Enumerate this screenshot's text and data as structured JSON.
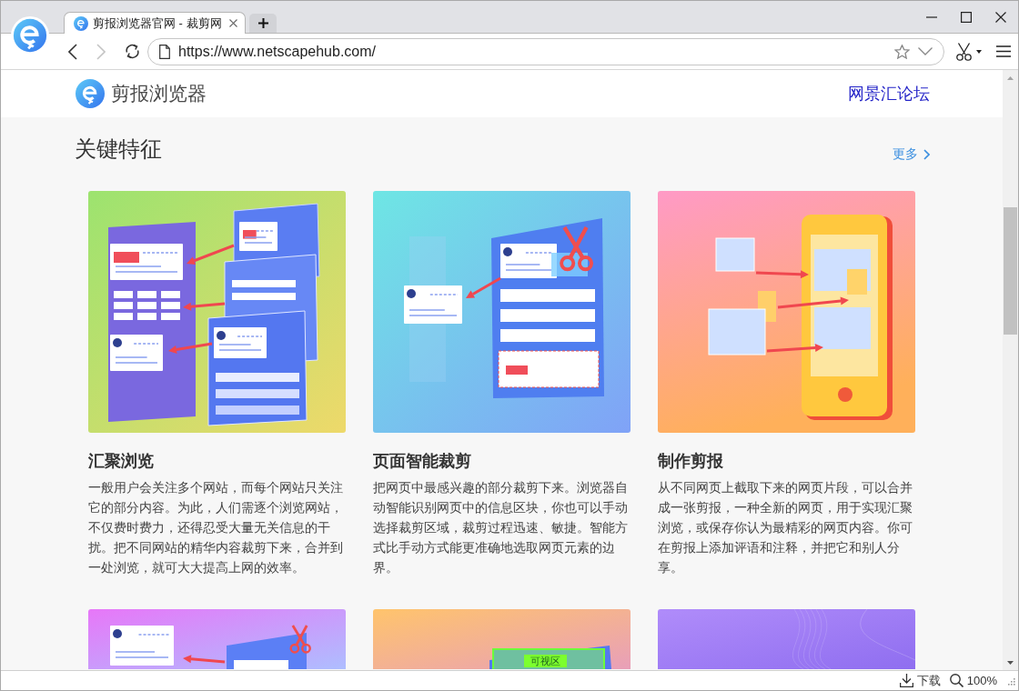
{
  "tabs": [
    {
      "title": "剪报浏览器官网 - 裁剪网",
      "selected": true
    }
  ],
  "nav_buttons": [
    {
      "kind": "back",
      "disabled": false
    },
    {
      "kind": "forward",
      "disabled": true
    }
  ],
  "address_bar": {
    "url": "https://www.netscapehub.com/"
  },
  "header": {
    "brand": "剪报浏览器",
    "link": "网景汇论坛"
  },
  "section": {
    "title": "关键特征",
    "more": "更多"
  },
  "cards": [
    {
      "kind": "collage",
      "title": "汇聚浏览",
      "description": "一般用户会关注多个网站，而每个网站只关注它的部分内容。为此，人们需逐个浏览网站，不仅费时费力，还得忍受大量无关信息的干扰。把不同网站的精华内容裁剪下来，合并到一处浏览，就可大大提高上网的效率。"
    },
    {
      "kind": "clipping",
      "title": "页面智能裁剪",
      "description": "把网页中最感兴趣的部分裁剪下来。浏览器自动智能识别网页中的信息区块，你也可以手动选择裁剪区域，裁剪过程迅速、敏捷。智能方式比手动方式能更准确地选取网页元素的边界。"
    },
    {
      "kind": "phone",
      "title": "制作剪报",
      "description": "从不同网页上截取下来的网页片段，可以合并成一张剪报，一种全新的网页，用于实现汇聚浏览，或保存你认为最精彩的网页内容。你可在剪报上添加评语和注释，并把它和别人分享。"
    }
  ],
  "more_cards": [
    {
      "kind": "clip"
    },
    {
      "kind": "visible-area",
      "label": "可视区"
    },
    {
      "kind": "waves"
    }
  ],
  "status_bar": {
    "download": "下载",
    "zoom": "100%"
  }
}
